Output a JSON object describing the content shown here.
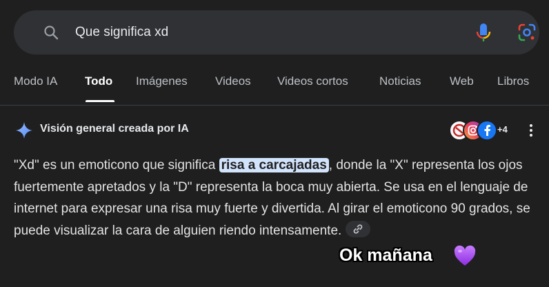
{
  "search": {
    "query": "Que significa xd"
  },
  "tabs": [
    {
      "label": "Modo IA"
    },
    {
      "label": "Todo"
    },
    {
      "label": "Imágenes"
    },
    {
      "label": "Videos"
    },
    {
      "label": "Videos cortos"
    },
    {
      "label": "Noticias"
    },
    {
      "label": "Web"
    },
    {
      "label": "Libros"
    }
  ],
  "active_tab": "Todo",
  "ai_overview": {
    "title": "Visión general creada por IA",
    "sources_more": "+4",
    "text_before": "\"Xd\" es un emoticono que significa ",
    "highlight": "risa a carcajadas",
    "text_after": ", donde la \"X\" representa los ojos fuertemente apretados y la \"D\" representa la boca muy abierta. Se usa en el lenguaje de internet para expresar una risa muy fuerte y divertida. Al girar el emoticono 90 grados, se puede visualizar la cara de alguien riendo intensamente."
  },
  "overlay": {
    "text": "Ok mañana"
  },
  "icons": {
    "search": "search-icon",
    "mic": "mic-icon",
    "lens": "lens-icon",
    "sparkle": "sparkle-icon",
    "link": "link-icon",
    "more": "kebab-icon",
    "heart": "purple-heart-icon"
  },
  "colors": {
    "background": "#1f1f1f",
    "search_bar": "#303134",
    "highlight": "#d2e3fc",
    "heart": "#a855f7"
  }
}
